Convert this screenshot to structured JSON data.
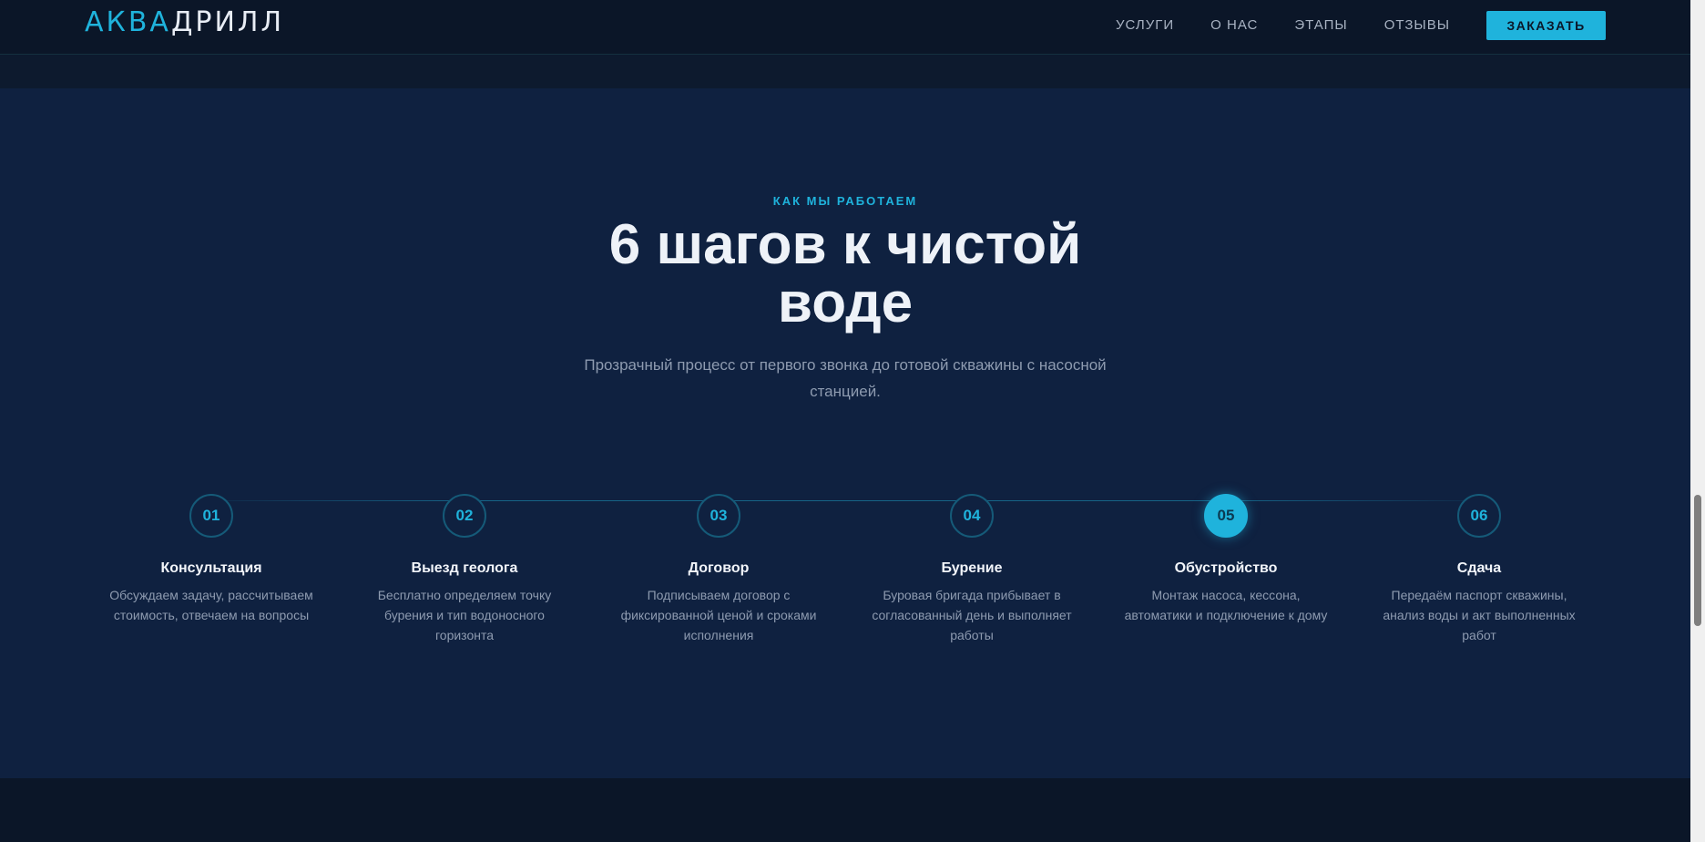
{
  "header": {
    "logo_accent": "АКВА",
    "logo_rest": "ДРИЛЛ",
    "nav": [
      "УСЛУГИ",
      "О НАС",
      "ЭТАПЫ",
      "ОТЗЫВЫ"
    ],
    "order_label": "ЗАКАЗАТЬ"
  },
  "section": {
    "eyebrow": "КАК МЫ РАБОТАЕМ",
    "title_line1": "6 шагов к чистой",
    "title_line2": "воде",
    "subtitle": "Прозрачный процесс от первого звонка до готовой скважины с насосной станцией."
  },
  "steps": [
    {
      "num": "01",
      "title": "Консультация",
      "desc": "Обсуждаем задачу, рассчитываем стоимость, отвечаем на вопросы"
    },
    {
      "num": "02",
      "title": "Выезд геолога",
      "desc": "Бесплатно определяем точку бурения и тип водоносного горизонта"
    },
    {
      "num": "03",
      "title": "Договор",
      "desc": "Подписываем договор с фиксированной ценой и сроками исполнения"
    },
    {
      "num": "04",
      "title": "Бурение",
      "desc": "Буровая бригада прибывает в согласованный день и выполняет работы"
    },
    {
      "num": "05",
      "title": "Обустройство",
      "desc": "Монтаж насоса, кессона, автоматики и подключение к дому",
      "active": true
    },
    {
      "num": "06",
      "title": "Сдача",
      "desc": "Передаём паспорт скважины, анализ воды и акт выполненных работ"
    }
  ],
  "colors": {
    "accent": "#1fb3dc",
    "background": "#0b1628",
    "section_bg": "#0f2140"
  }
}
